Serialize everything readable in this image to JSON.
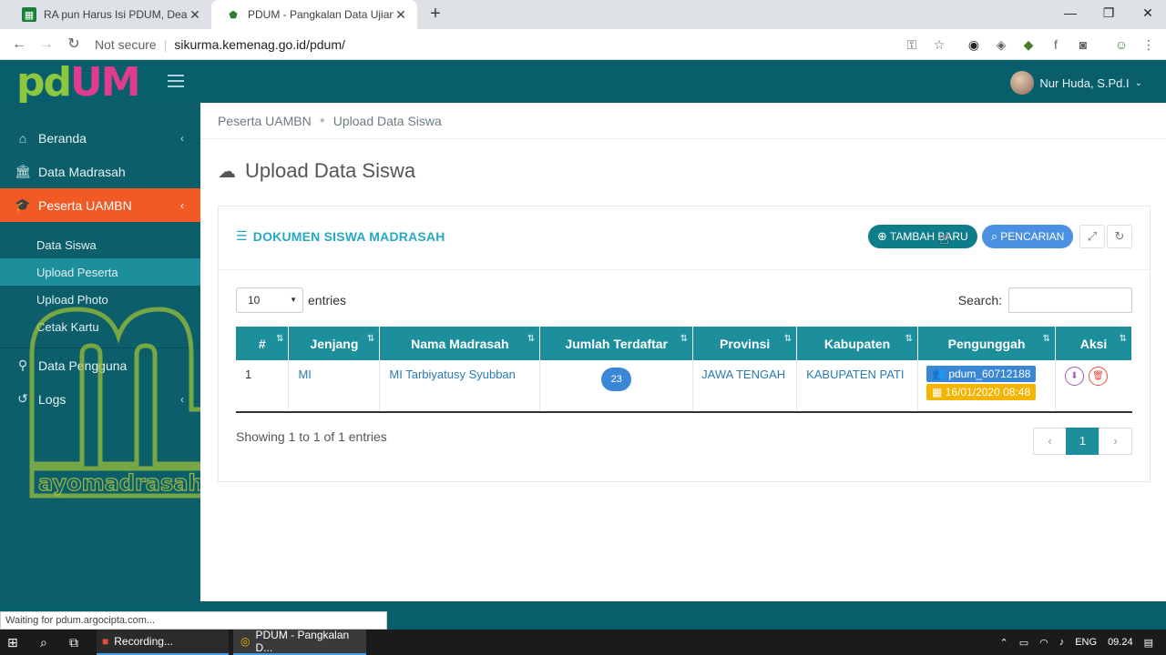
{
  "browser": {
    "tabs": [
      {
        "title": "RA pun Harus Isi PDUM, Deadline"
      },
      {
        "title": "PDUM - Pangkalan Data Ujian M"
      }
    ],
    "not_secure": "Not secure",
    "url": "sikurma.kemenag.go.id/pdum/",
    "status": "Waiting for pdum.argocipta.com..."
  },
  "header": {
    "logo_pd": "pd",
    "logo_um": "UM",
    "user_name": "Nur Huda, S.Pd.I"
  },
  "sidebar": {
    "items": [
      {
        "label": "Beranda"
      },
      {
        "label": "Data Madrasah"
      },
      {
        "label": "Peserta UAMBN"
      },
      {
        "label": "Data Pengguna"
      },
      {
        "label": "Logs"
      }
    ],
    "subitems": [
      {
        "label": "Data Siswa"
      },
      {
        "label": "Upload Peserta"
      },
      {
        "label": "Upload Photo"
      },
      {
        "label": "Cetak Kartu"
      }
    ],
    "watermark": "ayomadrasah"
  },
  "breadcrumb": {
    "root": "Peserta UAMBN",
    "current": "Upload Data Siswa"
  },
  "page_title": "Upload Data Siswa",
  "panel": {
    "title": "DOKUMEN SISWA MADRASAH",
    "add_label": "TAMBAH BARU",
    "search_label": "PENCARIAN",
    "length_value": "10",
    "entries_label": "entries",
    "search_label_text": "Search:",
    "info": "Showing 1 to 1 of 1 entries",
    "page_current": "1"
  },
  "table": {
    "headers": [
      "#",
      "Jenjang",
      "Nama Madrasah",
      "Jumlah Terdaftar",
      "Provinsi",
      "Kabupaten",
      "Pengunggah",
      "Aksi"
    ],
    "rows": [
      {
        "no": "1",
        "jenjang": "MI",
        "nama": "MI Tarbiyatusy Syubban",
        "jumlah": "23",
        "provinsi": "JAWA TENGAH",
        "kabupaten": "KABUPATEN PATI",
        "uploader": "pdum_60712188",
        "tanggal": "16/01/2020 08:48"
      }
    ]
  },
  "taskbar": {
    "app1": "Recording...",
    "app2": "PDUM - Pangkalan D...",
    "lang": "ENG",
    "time": "09.24"
  }
}
